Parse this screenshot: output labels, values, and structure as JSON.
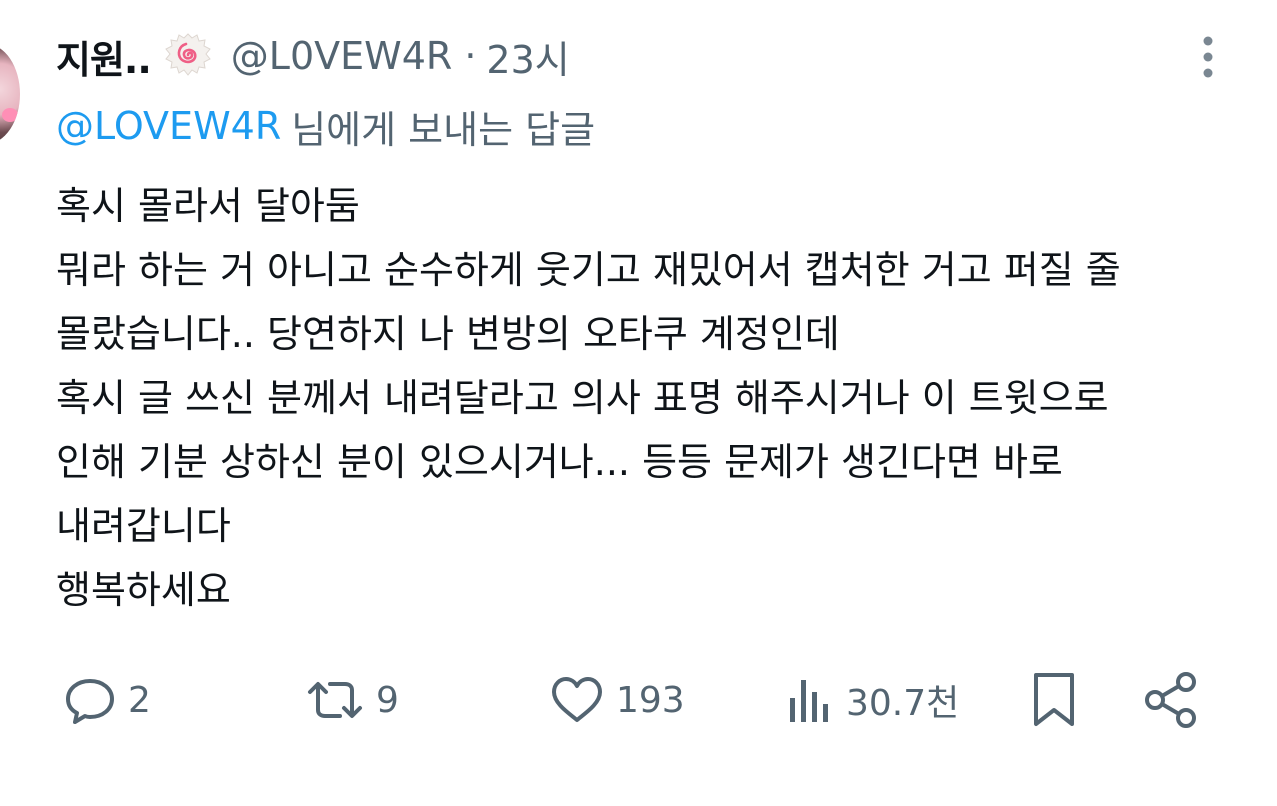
{
  "colors": {
    "primary_text": "#0f1419",
    "secondary_text": "#536471",
    "link": "#1d9bf0",
    "background": "#ffffff"
  },
  "tweet": {
    "author": {
      "display_name": "지원..",
      "emoji_icon": "narutomaki-icon",
      "handle": "@L0VEW4R",
      "separator": "·",
      "time": "23시"
    },
    "reply_to": {
      "handle": "@LOVEW4R",
      "suffix": "님에게 보내는 답글"
    },
    "body_lines": [
      "혹시 몰라서 달아둠",
      "뭐라 하는 거 아니고 순수하게 웃기고 재밌어서 캡처한 거고 퍼질 줄",
      "몰랐습니다.. 당연하지 나 변방의 오타쿠 계정인데",
      "혹시 글 쓰신 분께서 내려달라고 의사 표명 해주시거나 이 트윗으로",
      "인해 기분 상하신 분이 있으시거나... 등등 문제가 생긴다면 바로",
      "내려갑니다",
      "행복하세요"
    ],
    "actions": {
      "reply": {
        "icon": "comment-icon",
        "count": "2"
      },
      "retweet": {
        "icon": "retweet-icon",
        "count": "9"
      },
      "like": {
        "icon": "heart-icon",
        "count": "193"
      },
      "views": {
        "icon": "views-chart-icon",
        "count": "30.7천"
      },
      "bookmark": {
        "icon": "bookmark-icon"
      },
      "share": {
        "icon": "share-icon"
      }
    },
    "more_icon": "more-vertical-icon"
  }
}
